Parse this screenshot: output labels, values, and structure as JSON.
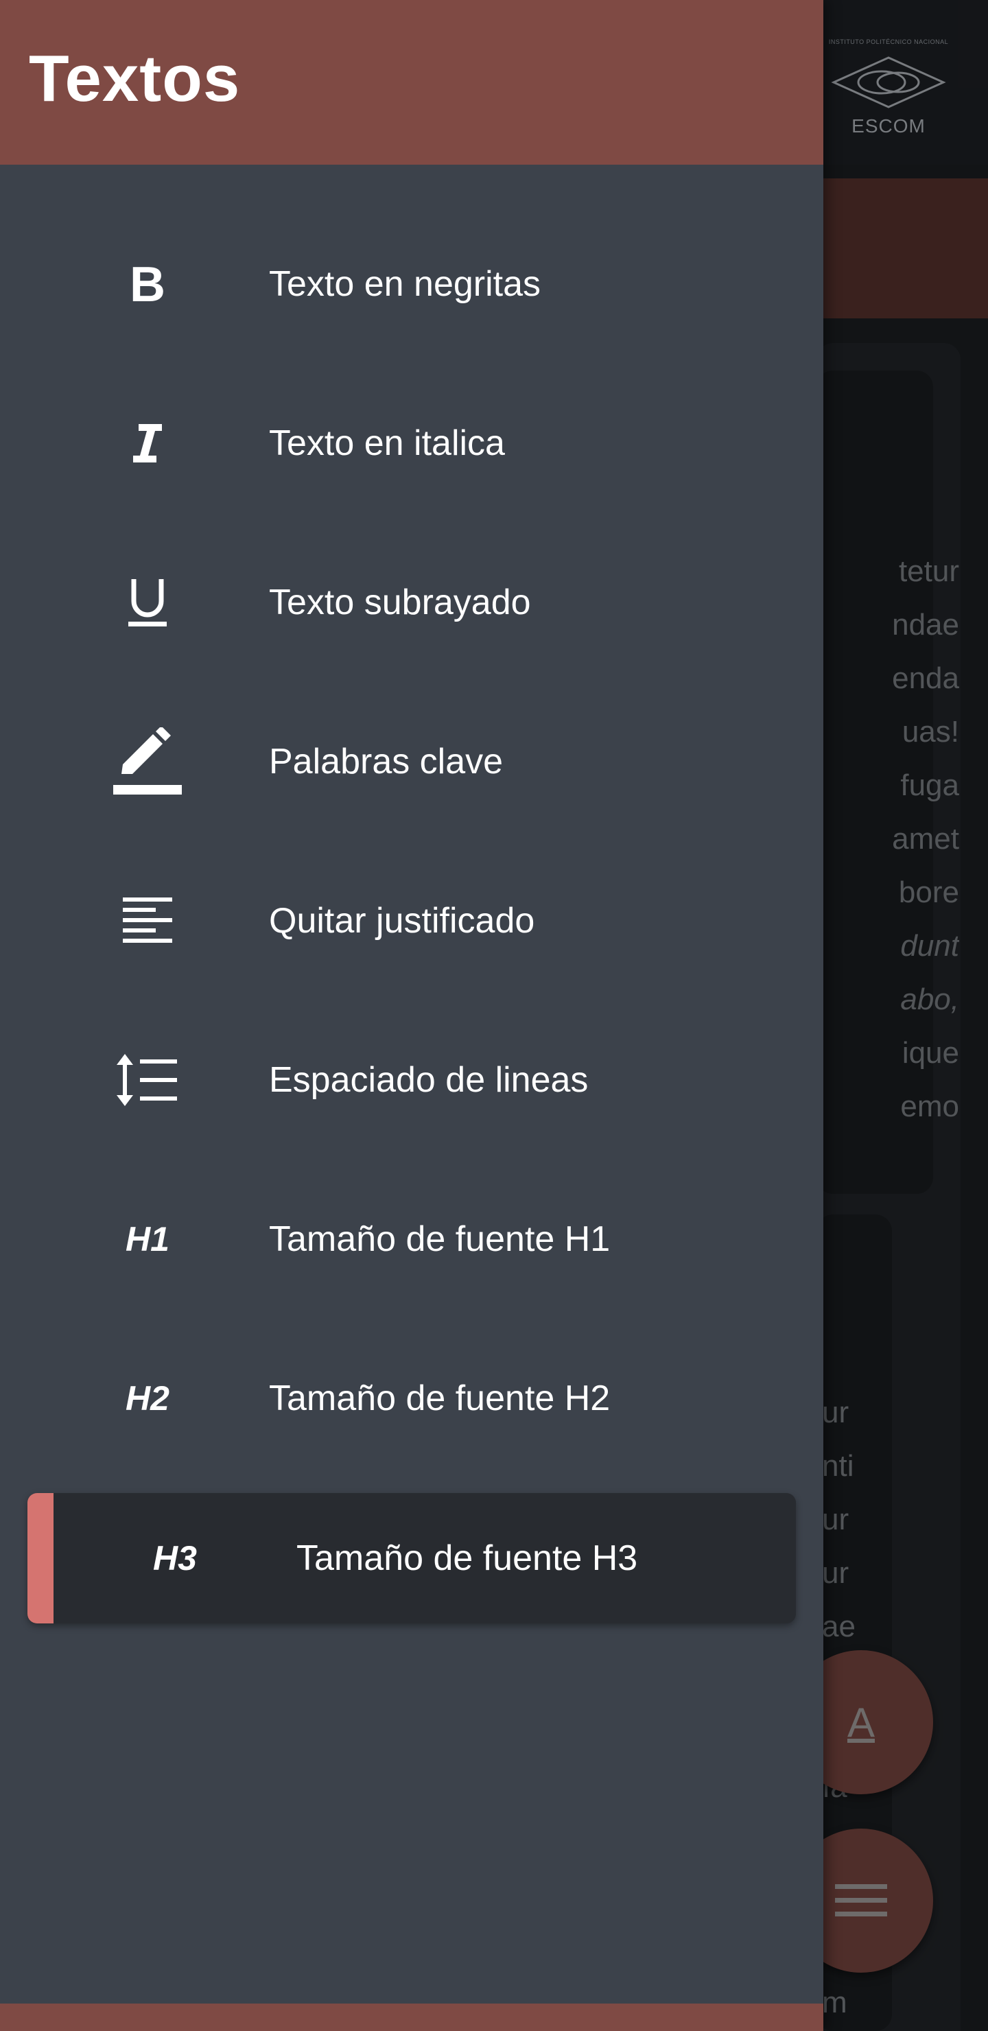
{
  "background": {
    "logo": {
      "institution": "INSTITUTO POLITÉCNICO NACIONAL",
      "name": "ESCOM"
    },
    "text_lines": [
      "tetur",
      "ndae",
      "enda",
      "uas!",
      "fuga",
      "amet",
      "bore",
      "dunt",
      "abo,",
      "ique",
      "emo"
    ],
    "text_lines_2": [
      "ur",
      "nti",
      "ur",
      "ur",
      "ae",
      "",
      "ıa",
      "",
      "",
      "m"
    ],
    "fab_font_label": "A"
  },
  "drawer": {
    "title": "Textos",
    "items": [
      {
        "icon": "bold-icon",
        "label": "Texto en negritas"
      },
      {
        "icon": "italic-icon",
        "label": "Texto en italica"
      },
      {
        "icon": "underline-icon",
        "label": "Texto subrayado"
      },
      {
        "icon": "highlight-pen-icon",
        "label": "Palabras clave"
      },
      {
        "icon": "align-left-icon",
        "label": "Quitar justificado"
      },
      {
        "icon": "line-spacing-icon",
        "label": "Espaciado de lineas"
      },
      {
        "icon": "h1-icon",
        "icon_text": "H1",
        "label": "Tamaño de fuente H1"
      },
      {
        "icon": "h2-icon",
        "icon_text": "H2",
        "label": "Tamaño de fuente H2"
      },
      {
        "icon": "h3-icon",
        "icon_text": "H3",
        "label": "Tamaño de fuente H3",
        "selected": true
      }
    ]
  },
  "colors": {
    "header": "#7f4a44",
    "drawer_bg": "#3c424b",
    "selected_bg": "#282b30",
    "selected_accent": "#d57470"
  }
}
